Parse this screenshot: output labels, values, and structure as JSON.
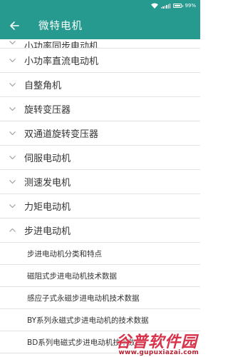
{
  "status_bar": {
    "battery_text": "99%"
  },
  "header": {
    "title": "微特电机"
  },
  "list": {
    "items": [
      {
        "label": "小功率同步电动机",
        "expanded": false
      },
      {
        "label": "小功率直流电动机",
        "expanded": false
      },
      {
        "label": "自整角机",
        "expanded": false
      },
      {
        "label": "旋转变压器",
        "expanded": false
      },
      {
        "label": "双通道旋转变压器",
        "expanded": false
      },
      {
        "label": "伺服电动机",
        "expanded": false
      },
      {
        "label": "测速发电机",
        "expanded": false
      },
      {
        "label": "力矩电动机",
        "expanded": false
      },
      {
        "label": "步进电动机",
        "expanded": true
      }
    ],
    "children": [
      "步进电动机分类和特点",
      "磁阻式步进电动机技术数据",
      "感应子式永磁步进电动机技术数据",
      "BY系列永磁式步进电动机的技术数据",
      "BD系列电磁式步进电动机技术数据"
    ]
  },
  "watermark": {
    "name": "谷普软件园",
    "url": "www.gupuxiazai.com"
  },
  "colors": {
    "accent": "#269a8f",
    "text": "#333333",
    "divider": "#e3e3e3",
    "chevron": "#9a9a9a"
  }
}
